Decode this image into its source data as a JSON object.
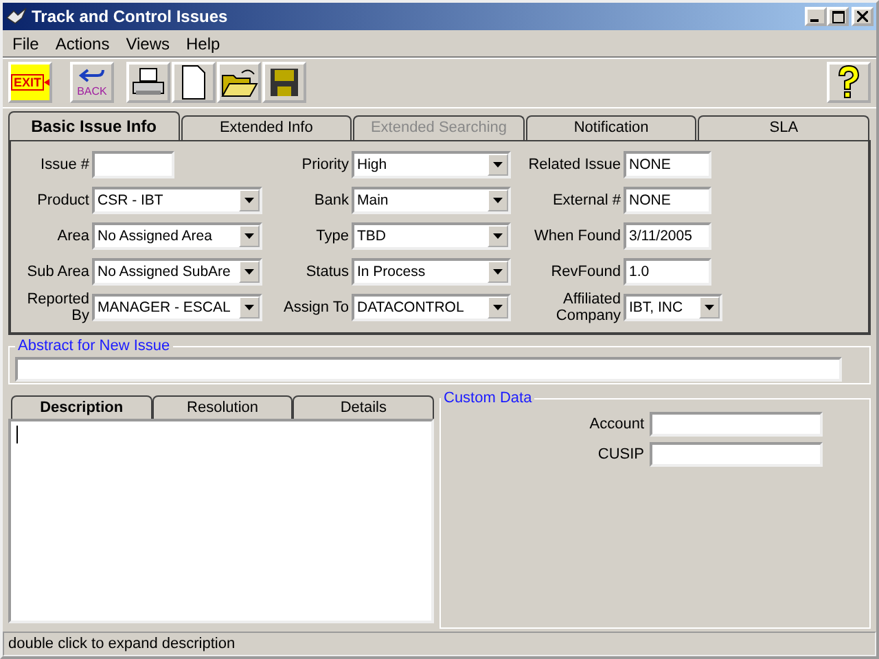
{
  "window": {
    "title": "Track and Control Issues"
  },
  "menu": [
    "File",
    "Actions",
    "Views",
    "Help"
  ],
  "toolbar": [
    {
      "kind": "exit",
      "label": "EXIT"
    },
    {
      "kind": "back",
      "label": "BACK"
    },
    {
      "kind": "print"
    },
    {
      "kind": "new"
    },
    {
      "kind": "open"
    },
    {
      "kind": "save"
    }
  ],
  "tabs": [
    {
      "label": "Basic Issue Info",
      "selected": true,
      "disabled": false
    },
    {
      "label": "Extended Info",
      "selected": false,
      "disabled": false
    },
    {
      "label": "Extended Searching",
      "selected": false,
      "disabled": true
    },
    {
      "label": "Notification",
      "selected": false,
      "disabled": false
    },
    {
      "label": "SLA",
      "selected": false,
      "disabled": false
    }
  ],
  "columns": [
    [
      {
        "label": "Issue #",
        "kind": "text"
      },
      {
        "label": "Product",
        "kind": "combo",
        "value": "CSR - IBT"
      },
      {
        "label": "Area",
        "kind": "combo",
        "value": "No Assigned Area"
      },
      {
        "label": "Sub Area",
        "kind": "combo",
        "value": "No Assigned SubAre"
      },
      {
        "label": "Reported By",
        "kind": "combo",
        "value": "MANAGER - ESCAL"
      }
    ],
    [
      {
        "label": "Priority",
        "kind": "combo",
        "value": "High"
      },
      {
        "label": "Bank",
        "kind": "combo",
        "value": "Main"
      },
      {
        "label": "Type",
        "kind": "combo",
        "value": "TBD"
      },
      {
        "label": "Status",
        "kind": "combo",
        "value": "In Process"
      },
      {
        "label": "Assign To",
        "kind": "combo",
        "value": "DATACONTROL"
      }
    ],
    [
      {
        "label": "Related Issue",
        "kind": "text",
        "value": "NONE"
      },
      {
        "label": "External #",
        "kind": "text",
        "value": "NONE"
      },
      {
        "label": "When Found",
        "kind": "text",
        "value": "3/11/2005"
      },
      {
        "label": "RevFound",
        "kind": "text",
        "value": "1.0"
      },
      {
        "label": "Affiliated Company",
        "kind": "combo",
        "value": "IBT, INC"
      }
    ]
  ],
  "abstract": {
    "title": "Abstract for New Issue"
  },
  "detail_tabs": [
    {
      "label": "Description",
      "selected": true
    },
    {
      "label": "Resolution",
      "selected": false
    },
    {
      "label": "Details",
      "selected": false
    }
  ],
  "custom_data": {
    "title": "Custom Data",
    "fields": [
      {
        "label": "Account"
      },
      {
        "label": "CUSIP"
      }
    ]
  },
  "status_bar": "double click to expand description"
}
